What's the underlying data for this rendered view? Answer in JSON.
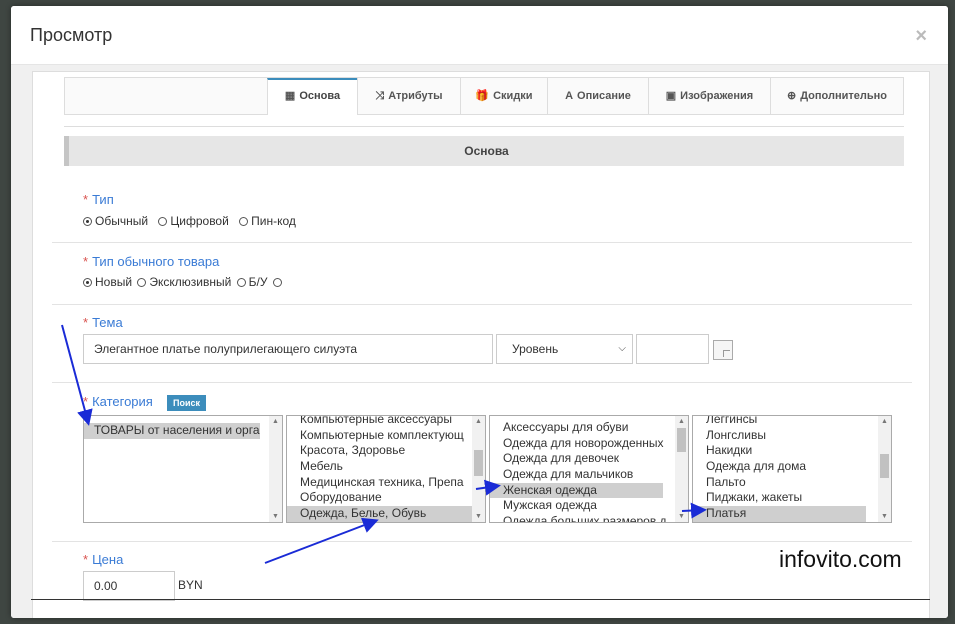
{
  "modal": {
    "title": "Просмотр",
    "close": "×"
  },
  "tabs": [
    {
      "label": "Основа",
      "icon": "▦"
    },
    {
      "label": "Атрибуты",
      "icon": "⤨"
    },
    {
      "label": "Скидки",
      "icon": "🎁"
    },
    {
      "label": "Описание",
      "icon": "A"
    },
    {
      "label": "Изображения",
      "icon": "▣"
    },
    {
      "label": "Дополнительно",
      "icon": "⊕"
    }
  ],
  "section": {
    "title": "Основа"
  },
  "fields": {
    "type": {
      "label": "Тип",
      "options": [
        "Обычный",
        "Цифровой",
        "Пин-код"
      ]
    },
    "product_type": {
      "label": "Тип обычного товара",
      "options": [
        "Новый",
        "Эксклюзивный",
        "Б/У",
        ""
      ]
    },
    "theme": {
      "label": "Тема",
      "value": "Элегантное платье полуприлегающего силуэта",
      "level_select": "Уровень",
      "extra_value": ""
    },
    "category": {
      "label": "Категория",
      "search_button": "Поиск",
      "list1": [
        "ТОВАРЫ от населения и орга"
      ],
      "list2": [
        "Компьютерные аксессуары",
        "Компьютерные комплектующ",
        "Красота, Здоровье",
        "Мебель",
        "Медицинская техника, Препа",
        "Оборудование",
        "Одежда, Белье, Обувь"
      ],
      "list3": [
        "Аксессуары для обуви",
        "Одежда для новорожденных",
        "Одежда для девочек",
        "Одежда для мальчиков",
        "Женская одежда",
        "Мужская одежда",
        "Одежда больших размеров д"
      ],
      "list4": [
        "Леггинсы",
        "Лонгсливы",
        "Накидки",
        "Одежда для дома",
        "Пальто",
        "Пиджаки, жакеты",
        "Платья"
      ]
    },
    "price": {
      "label": "Цена",
      "value": "0.00",
      "unit": "BYN"
    }
  },
  "watermark": "infovito.com",
  "colors": {
    "accent": "#3c8dbc",
    "label": "#3a7bd5",
    "required": "#d9534f",
    "arrow": "#1a2bd6"
  }
}
